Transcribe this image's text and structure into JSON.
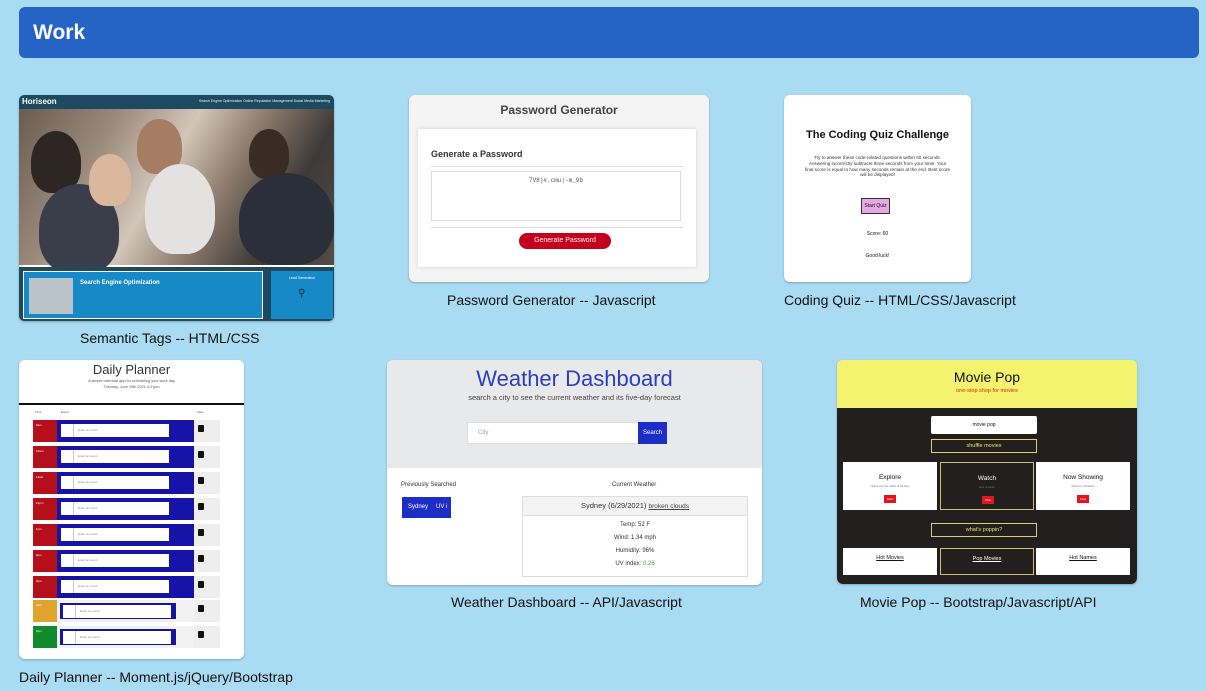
{
  "header": {
    "title": "Work"
  },
  "projects": [
    {
      "caption": "Semantic Tags -- HTML/CSS",
      "thumb": {
        "logo": "Horiseon",
        "nav": "Search Engine Optimization   Online Reputation Management   Social Media Marketing",
        "panel_title": "Search Engine Optimization",
        "side_title": "Lead Generation"
      }
    },
    {
      "caption": "Password Generator -- Javascript",
      "thumb": {
        "title": "Password Generator",
        "subtitle": "Generate a Password",
        "password": "7V8)#.cmu|-m_9b",
        "button": "Generate Password"
      }
    },
    {
      "caption": "Coding Quiz -- HTML/CSS/Javascript",
      "thumb": {
        "title": "The Coding Quiz Challenge",
        "text": "Try to answer these code-related questions within 60 seconds. Answering incorrectly subtracts three seconds from your timer. Your final score is equal to how many seconds remain at the end. Best score will be displayed!",
        "button": "Start Quiz",
        "score": "Score: 60",
        "luck": "Good luck!"
      }
    },
    {
      "caption": "Daily Planner -- Moment.js/jQuery/Bootstrap",
      "thumb": {
        "title": "Daily Planner",
        "subtitle": "A simple calendar app for scheduling your work day",
        "date": "Tuesday, June 29th 2021 4:21pm",
        "col_time": "Time",
        "col_event": "Event",
        "col_save": "Save",
        "placeholder": "Enter an event",
        "rows": [
          {
            "hour": "9am",
            "state": "past"
          },
          {
            "hour": "10am",
            "state": "past"
          },
          {
            "hour": "11am",
            "state": "past"
          },
          {
            "hour": "12pm",
            "state": "past"
          },
          {
            "hour": "1pm",
            "state": "past"
          },
          {
            "hour": "2pm",
            "state": "past"
          },
          {
            "hour": "3pm",
            "state": "past"
          },
          {
            "hour": "4pm",
            "state": "present"
          },
          {
            "hour": "5pm",
            "state": "future"
          }
        ]
      }
    },
    {
      "caption": "Weather Dashboard -- API/Javascript",
      "thumb": {
        "title": "Weather Dashboard",
        "subtitle": "search a city to see the current weather and its five-day forecast",
        "input_placeholder": "City",
        "search_button": "Search",
        "prev_label": "Previously Searched",
        "history": [
          "Sydney",
          "UV i"
        ],
        "current_label": "Current Weather",
        "heading": "Sydney (6/29/2021)",
        "conditions": "broken clouds",
        "temp": "Temp: 52 F",
        "wind": "Wind: 1.34 mph",
        "humidity": "Humidity: 96%",
        "uv_label": "UV index:",
        "uv_value": "0.26"
      }
    },
    {
      "caption": "Movie Pop -- Bootstrap/Javascript/API",
      "thumb": {
        "title": "Movie Pop",
        "subtitle": "one-stop shop for movies",
        "search_value": "movie pop",
        "shuffle": "shuffle movies",
        "cards": [
          {
            "title": "Explore",
            "sub": "check out top rated of all time",
            "btn": "Start"
          },
          {
            "title": "Watch",
            "sub": "pick a trailer",
            "btn": "View"
          },
          {
            "title": "Now Showing",
            "sub": "what's in theaters",
            "btn": "Find"
          }
        ],
        "poppin": "what's poppin?",
        "links": [
          "Hot Movies",
          "Pop Movies",
          "Hot Names"
        ]
      }
    }
  ],
  "colors": {
    "page_bg": "#a9dcf3",
    "header_bg": "#2563c4",
    "weather_accent": "#2c3fb8",
    "password_button": "#c4001d",
    "movie_yellow": "#f3f36f"
  }
}
